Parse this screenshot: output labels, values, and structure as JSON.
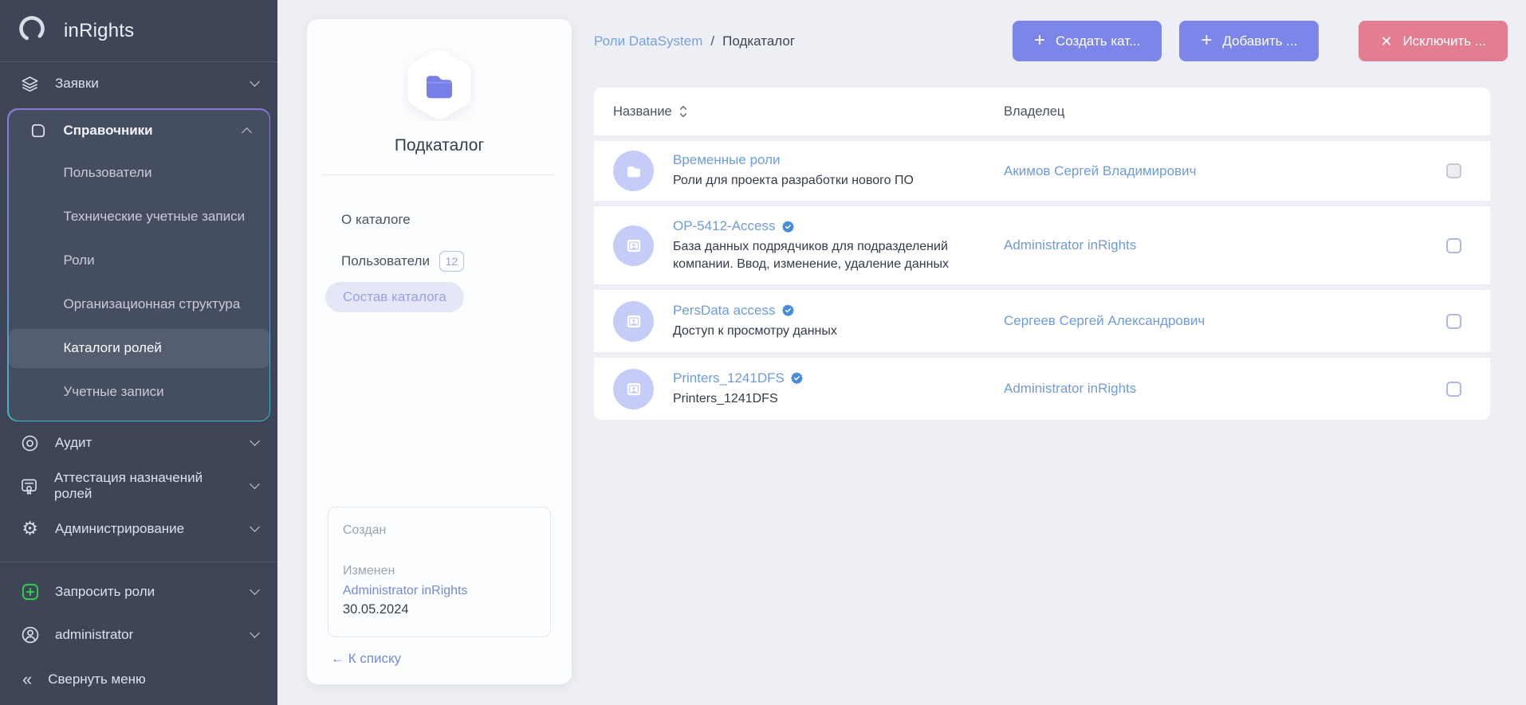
{
  "app": {
    "name": "inRights"
  },
  "colors": {
    "sidebar_bg": "#3d4557",
    "accent_indigo": "#7b86e8",
    "danger_pink": "#e27d92",
    "link_blue": "#6f9bd8",
    "panel_link_blue": "#7589d6",
    "verified_blue": "#478cdb",
    "request_green": "#2fd04a",
    "avatar_bg": "#c6ccf8"
  },
  "sidebar": {
    "logo": "inRights",
    "menu": [
      {
        "label": "Заявки",
        "icon": "layers-icon",
        "chevron": "down"
      },
      {
        "label": "Справочники",
        "icon": "folder-icon",
        "chevron": "up",
        "expanded": true
      }
    ],
    "directory_submenu": [
      "Пользователи",
      "Технические учетные записи",
      "Роли",
      "Организационная структура",
      "Каталоги ролей",
      "Учетные записи"
    ],
    "selected_submenu": "Каталоги ролей",
    "menu_lower": [
      {
        "label": "Аудит",
        "icon": "audit-icon",
        "chevron": "down"
      },
      {
        "label": "Аттестация назначений ролей",
        "icon": "certificate-icon",
        "chevron": "down"
      },
      {
        "label": "Администрирование",
        "icon": "gear-icon",
        "chevron": "down"
      }
    ],
    "footer_menu": [
      {
        "label": "Запросить роли",
        "icon": "request-roles-icon",
        "chevron": "down"
      },
      {
        "label": "administrator",
        "icon": "user-icon",
        "chevron": "down"
      }
    ],
    "collapse": "Свернуть меню",
    "collapse_icon": "«"
  },
  "panel": {
    "title": "Подкаталог",
    "icon": "folder-hexagon-icon",
    "tabs": [
      {
        "label": "О каталоге"
      },
      {
        "label": "Пользователи",
        "badge": "12"
      },
      {
        "label": "Состав каталога",
        "selected": true
      }
    ],
    "meta": {
      "created_label": "Создан",
      "modified_label": "Изменен",
      "modified_by": "Administrator inRights",
      "modified_date": "30.05.2024"
    },
    "back_link": "← К списку"
  },
  "main": {
    "breadcrumb": {
      "parent": "Роли DataSystem",
      "separator": "/",
      "current": "Подкаталог"
    },
    "buttons": [
      {
        "label": "Создать кат...",
        "icon": "plus-icon",
        "color": "#7b86e8"
      },
      {
        "label": "Добавить ...",
        "icon": "plus-icon",
        "color": "#7b86e8"
      },
      {
        "label": "Исключить ...",
        "icon": "x-icon",
        "color": "#e27d92"
      }
    ],
    "table": {
      "headers": {
        "name": "Название",
        "owner": "Владелец"
      },
      "rows": [
        {
          "title": "Временные роли",
          "verified": false,
          "icon": "folder",
          "subtitle": "Роли для проекта разработки нового ПО",
          "owner": "Акимов Сергей Владимирович",
          "checked": false
        },
        {
          "title": "OP-5412-Access",
          "verified": true,
          "icon": "id-card",
          "subtitle": "База данных подрядчиков для подразделений компании. Ввод, изменение, удаление данных",
          "owner": "Administrator inRights",
          "checked": false
        },
        {
          "title": "PersData access",
          "verified": true,
          "icon": "id-card",
          "subtitle": "Доступ к просмотру данных",
          "owner": "Сергеев Сергей Александрович",
          "checked": false
        },
        {
          "title": "Printers_1241DFS",
          "verified": true,
          "icon": "id-card",
          "subtitle": "Printers_1241DFS",
          "owner": "Administrator inRights",
          "checked": false
        }
      ]
    }
  }
}
